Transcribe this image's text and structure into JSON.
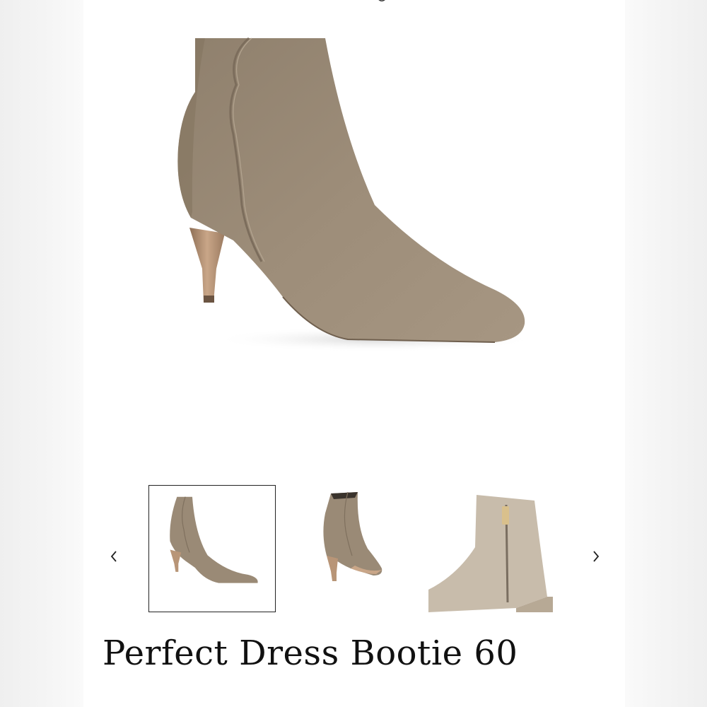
{
  "product": {
    "title": "Perfect Dress Bootie 60"
  },
  "gallery": {
    "selected_index": 0,
    "thumbnails": [
      {
        "name": "thumb-side-view",
        "selected": true
      },
      {
        "name": "thumb-back-view",
        "selected": false
      },
      {
        "name": "thumb-zipper-detail",
        "selected": false
      }
    ],
    "prev_icon": "chevron-left-icon",
    "next_icon": "chevron-right-icon"
  },
  "colors": {
    "suede": "#9a8a76",
    "suede_dark": "#7f705e",
    "suede_light": "#b7a995",
    "heel": "#b89577",
    "thumb3_suede": "#c8bcab"
  }
}
